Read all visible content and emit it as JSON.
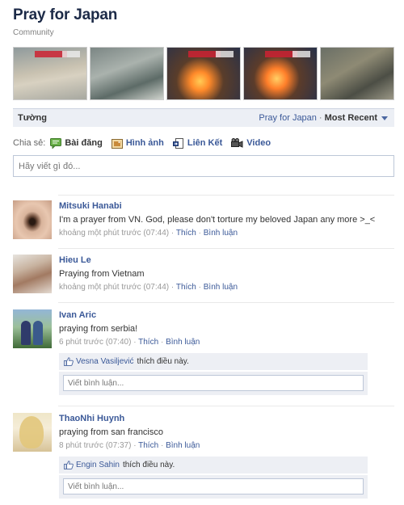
{
  "page": {
    "title": "Pray for Japan",
    "category": "Community"
  },
  "photos": [
    "photo-1",
    "photo-2",
    "photo-3",
    "photo-4",
    "photo-5"
  ],
  "wall": {
    "tab": "Tường",
    "filter_source": "Pray for Japan",
    "filter_separator": "·",
    "filter_sort": "Most Recent"
  },
  "share": {
    "label": "Chia sẻ:",
    "options": [
      "Bài đăng",
      "Hình ảnh",
      "Liên Kết",
      "Video"
    ],
    "icons": [
      "status-icon",
      "photo-icon",
      "link-icon",
      "video-icon"
    ]
  },
  "composer": {
    "placeholder": "Hãy viết gì đó..."
  },
  "posts": [
    {
      "author": "Mitsuki Hanabi",
      "message": "I'm a prayer from VN. God, please don't torture my beloved Japan any more >_<",
      "time": "khoảng một phút trước (07:44)",
      "like": "Thích",
      "comment": "Bình luận"
    },
    {
      "author": "Hieu Le",
      "message": "Praying from Vietnam",
      "time": "khoảng một phút trước (07:44)",
      "like": "Thích",
      "comment": "Bình luận"
    },
    {
      "author": "Ivan Aric",
      "message": "praying from serbia!",
      "time": "6 phút trước (07:40)",
      "like": "Thích",
      "comment": "Bình luận",
      "liked_by": "Vesna Vasiljević",
      "liked_text": "thích điều này.",
      "comment_placeholder": "Viết bình luận..."
    },
    {
      "author": "ThaoNhi Huynh",
      "message": "praying from san francisco",
      "time": "8 phút trước (07:37)",
      "like": "Thích",
      "comment": "Bình luận",
      "liked_by": "Engin Sahin",
      "liked_text": "thích điều này.",
      "comment_placeholder": "Viết bình luận..."
    }
  ],
  "meta_separator": "·",
  "colors": {
    "link": "#3b5998",
    "title": "#1c2a47",
    "bar_bg": "#eceff5",
    "like_box_bg": "#edeff4"
  }
}
